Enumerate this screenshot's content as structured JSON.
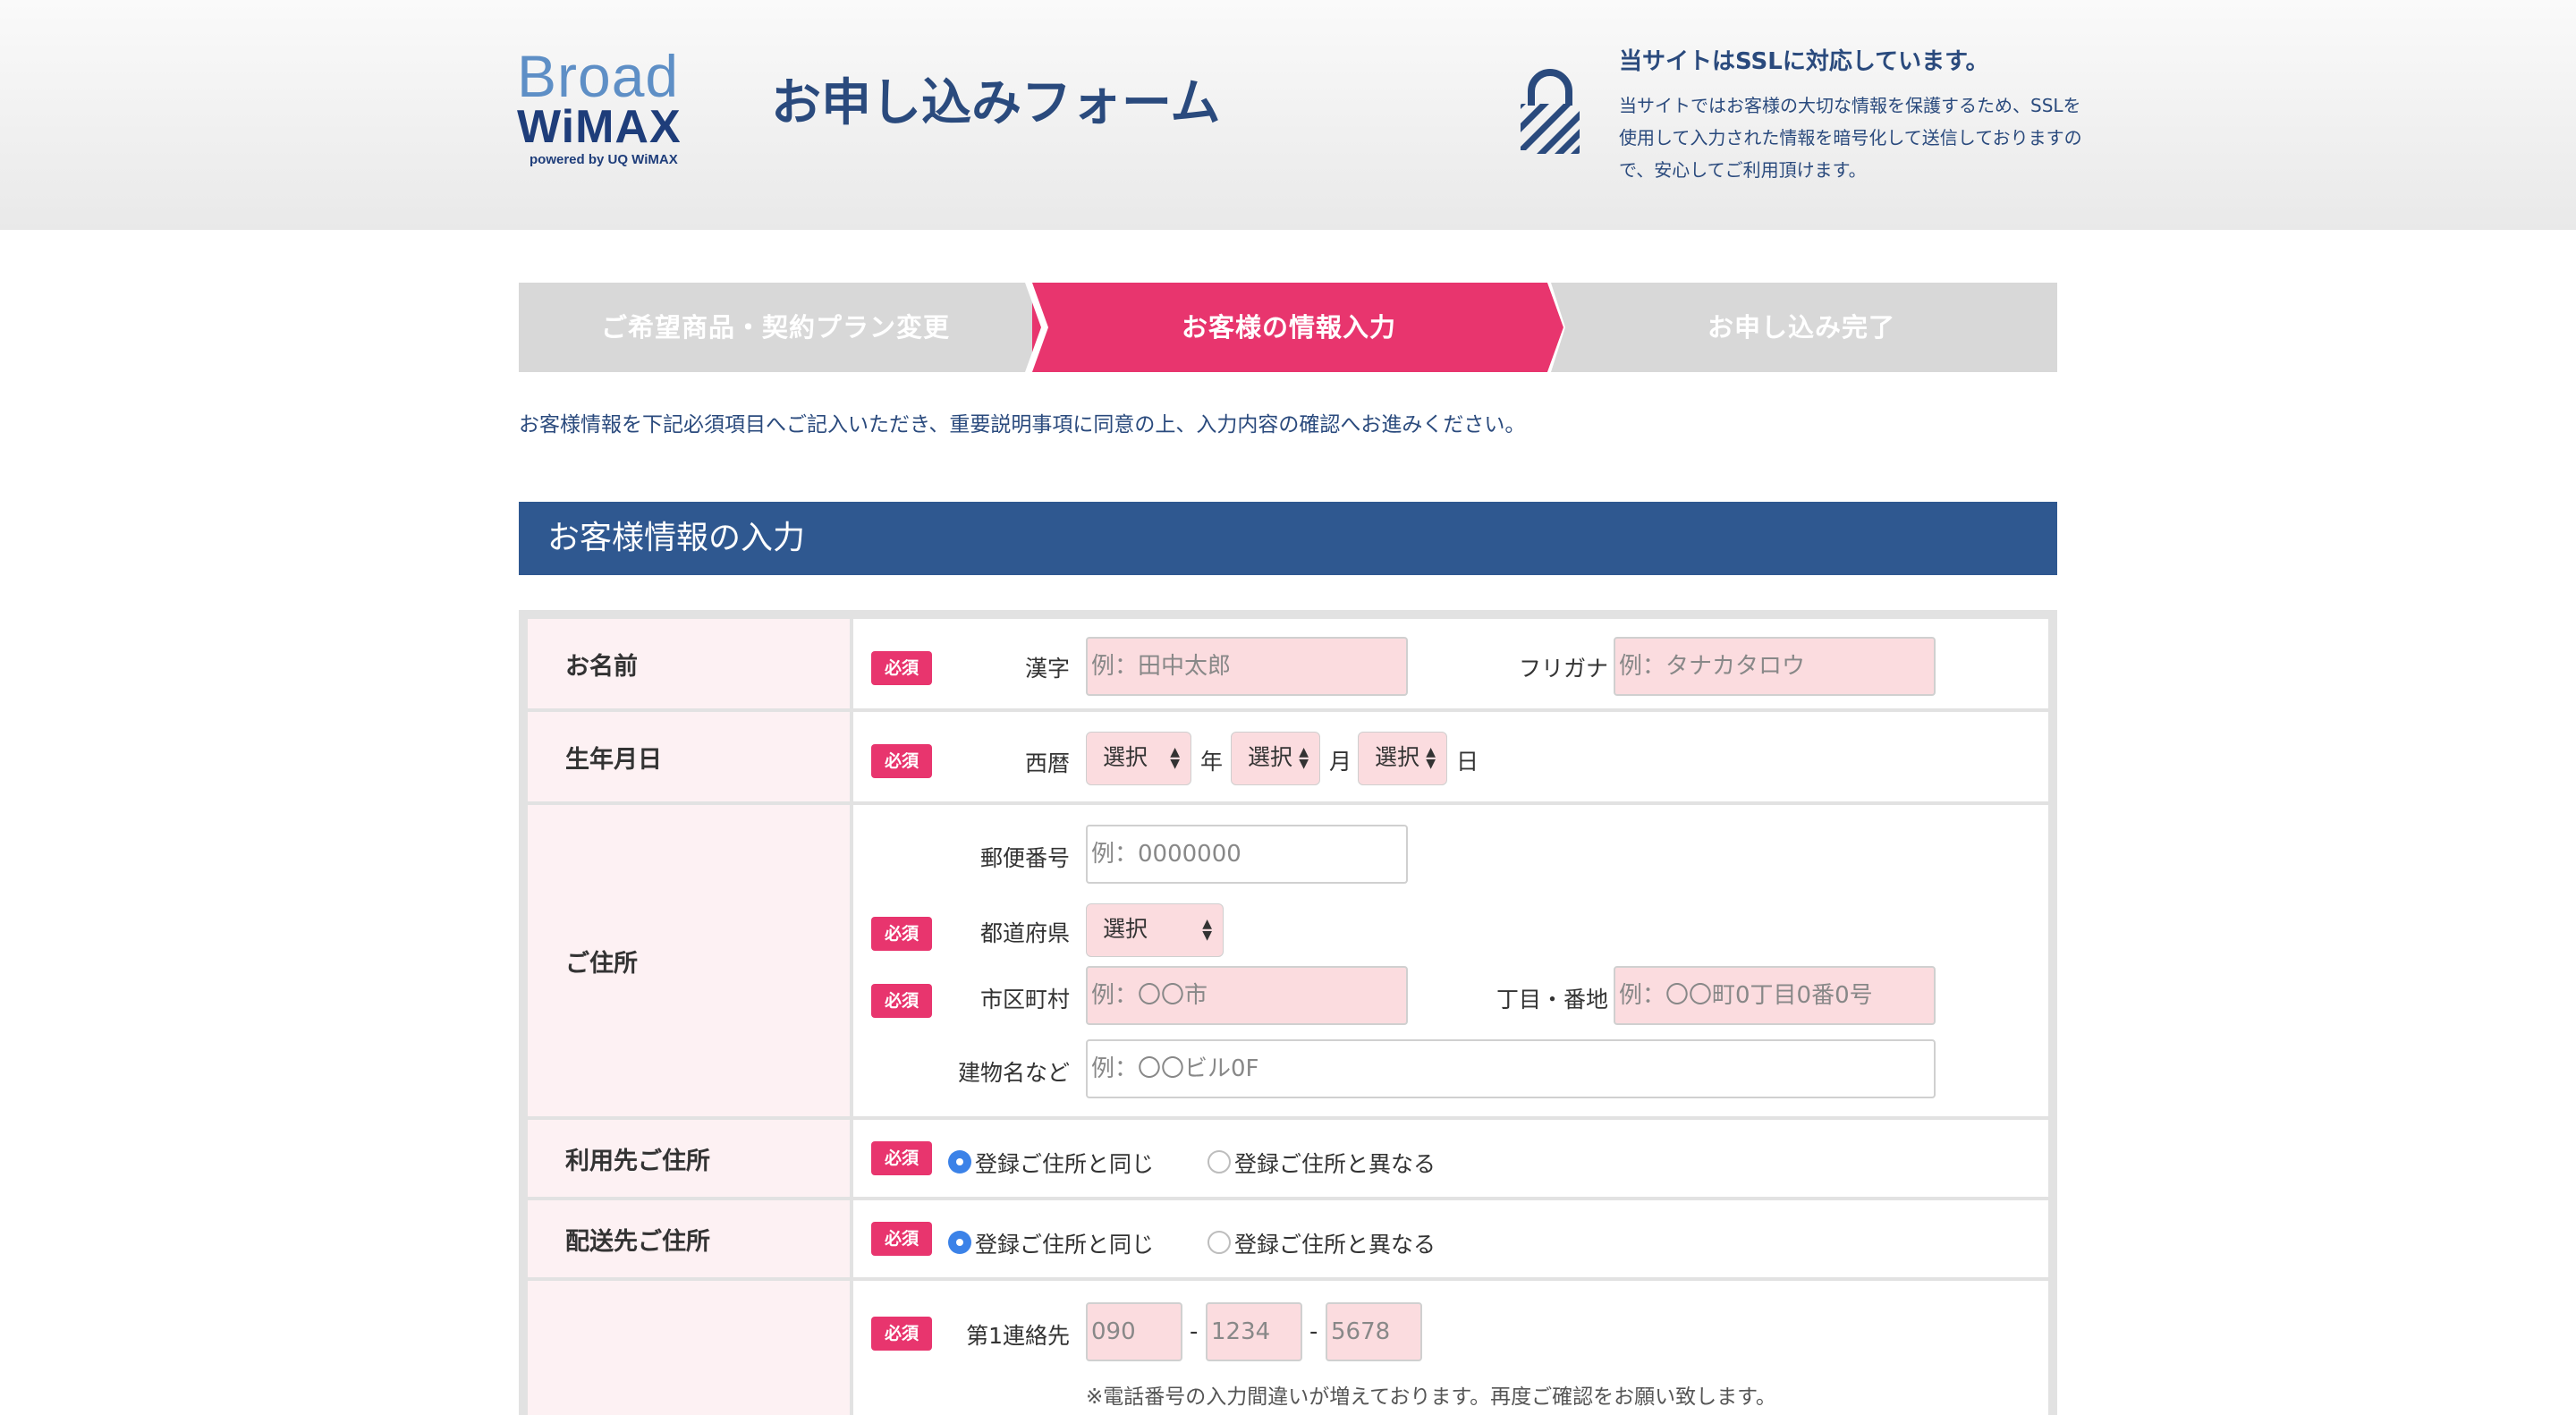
{
  "header": {
    "logo_broad": "Broad",
    "logo_wimax": "WiMAX",
    "logo_powered": "powered by UQ WiMAX",
    "title": "お申し込みフォーム",
    "ssl_title": "当サイトはSSLに対応しています。",
    "ssl_desc": "当サイトではお客様の大切な情報を保護するため、SSLを使用して入力された情報を暗号化して送信しておりますので、安心してご利用頂けます。"
  },
  "steps": [
    {
      "label": "ご希望商品・契約プラン変更",
      "active": false
    },
    {
      "label": "お客様の情報入力",
      "active": true
    },
    {
      "label": "お申し込み完了",
      "active": false
    }
  ],
  "intro": "お客様情報を下記必須項目へご記入いただき、重要説明事項に同意の上、入力内容の確認へお進みください。",
  "section_title": "お客様情報の入力",
  "required_badge": "必須",
  "form": {
    "name": {
      "label": "お名前",
      "kanji_label": "漢字",
      "kanji_placeholder": "例：田中太郎",
      "kana_label": "フリガナ",
      "kana_placeholder": "例：タナカタロウ"
    },
    "birth": {
      "label": "生年月日",
      "era_label": "西暦",
      "year_value": "選択",
      "year_unit": "年",
      "month_value": "選択",
      "month_unit": "月",
      "day_value": "選択",
      "day_unit": "日"
    },
    "address": {
      "label": "ご住所",
      "zip_label": "郵便番号",
      "zip_placeholder": "例：0000000",
      "pref_label": "都道府県",
      "pref_value": "選択",
      "city_label": "市区町村",
      "city_placeholder": "例：〇〇市",
      "street_label": "丁目・番地",
      "street_placeholder": "例：〇〇町0丁目0番0号",
      "building_label": "建物名など",
      "building_placeholder": "例：〇〇ビル0F"
    },
    "usage_address": {
      "label": "利用先ご住所",
      "option_same": "登録ご住所と同じ",
      "option_diff": "登録ご住所と異なる",
      "selected": "same"
    },
    "delivery_address": {
      "label": "配送先ご住所",
      "option_same": "登録ご住所と同じ",
      "option_diff": "登録ご住所と異なる",
      "selected": "same"
    },
    "phone": {
      "label": "",
      "contact_label": "第1連絡先",
      "part1_placeholder": "090",
      "part2_placeholder": "1234",
      "part3_placeholder": "5678",
      "separator": "-",
      "note": "※電話番号の入力間違いが増えております。再度ご確認をお願い致します。"
    }
  }
}
